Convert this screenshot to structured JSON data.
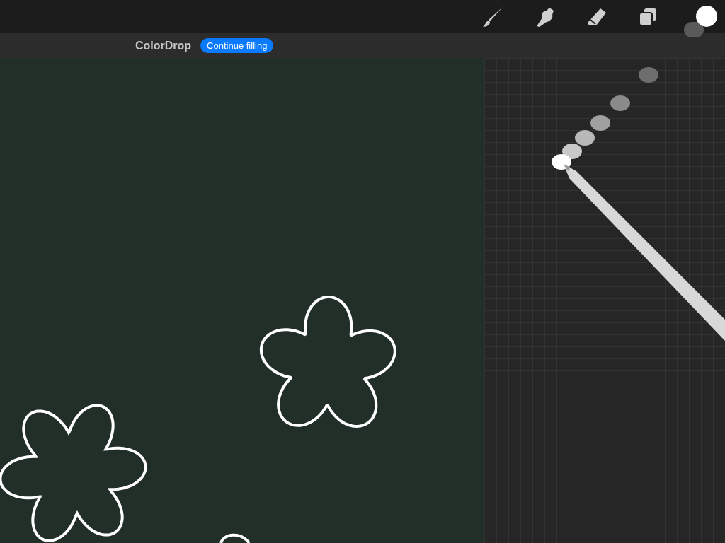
{
  "banner": {
    "title": "ColorDrop",
    "action": "Continue filling"
  }
}
